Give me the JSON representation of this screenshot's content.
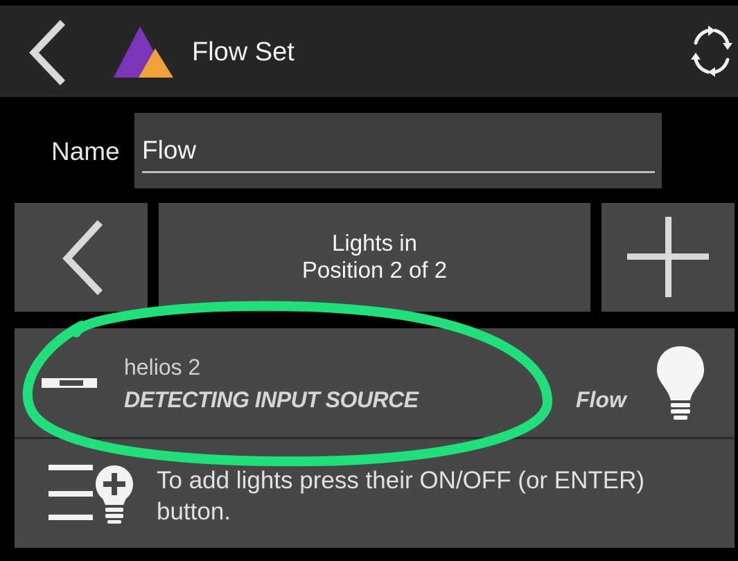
{
  "header": {
    "title": "Flow Set",
    "back_icon": "chevron-left-icon",
    "logo_icon": "app-logo-triangles",
    "sync_icon": "sync-arrows-icon",
    "colors": {
      "bar": "#262626",
      "logo_purple": "#7a35b8",
      "logo_orange": "#f0a13a"
    }
  },
  "name_field": {
    "label": "Name",
    "value": "Flow"
  },
  "position_nav": {
    "prev_icon": "chevron-left-icon",
    "line1": "Lights in",
    "line2": "Position 2 of 2",
    "add_icon": "plus-icon"
  },
  "light_item": {
    "name": "helios 2",
    "status": "DETECTING INPUT SOURCE",
    "mode": "Flow",
    "signal_icon": "signal-bar-icon",
    "bulb_icon": "lightbulb-icon"
  },
  "info": {
    "icon": "list-add-light-icon",
    "text": "To add lights press their ON/OFF (or ENTER) button."
  },
  "annotation": {
    "color": "#1fe07a"
  }
}
